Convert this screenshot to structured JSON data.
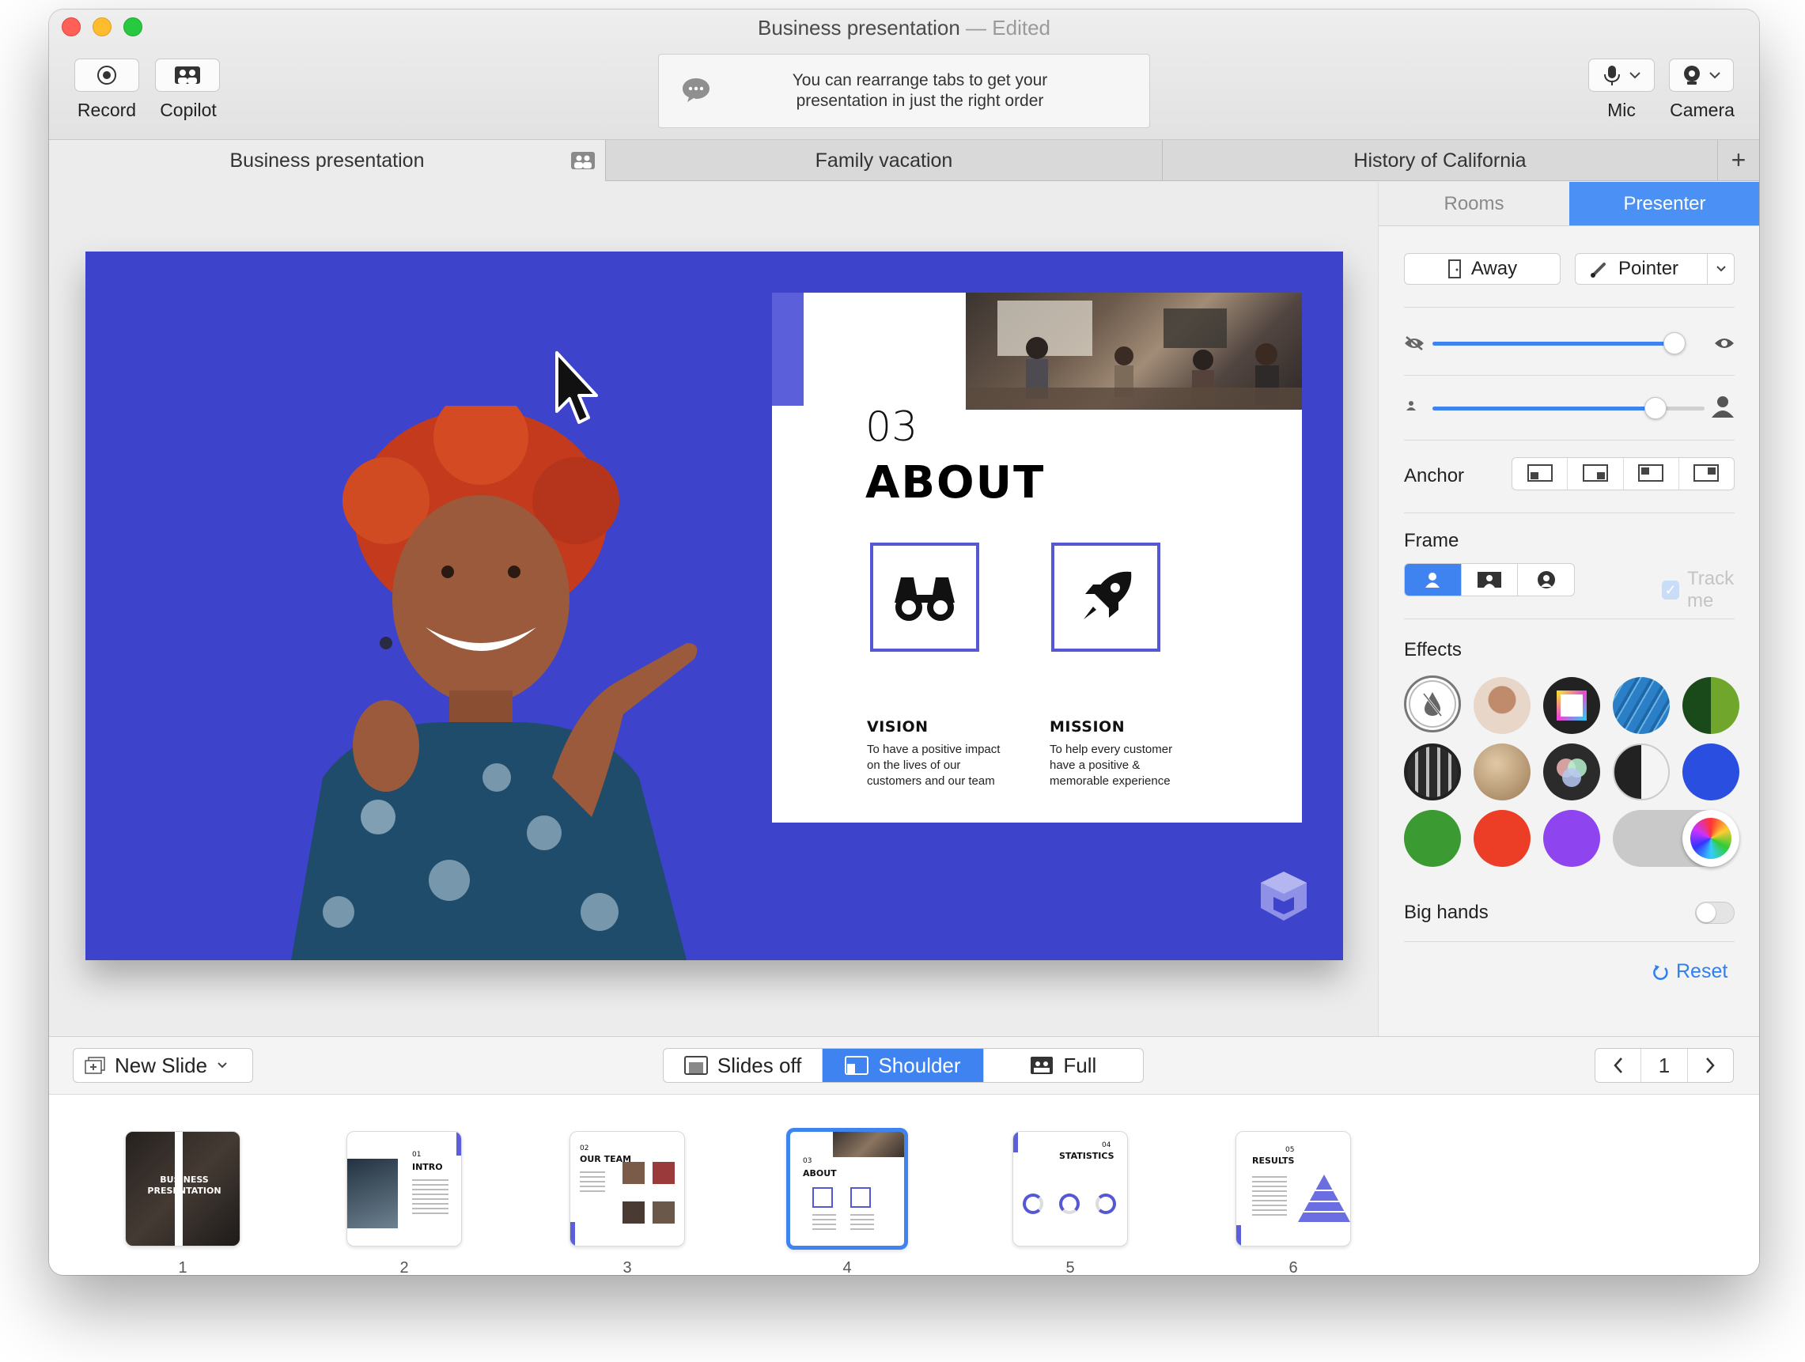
{
  "window": {
    "title": "Business presentation",
    "title_suffix": " — Edited"
  },
  "toolbar": {
    "record_label": "Record",
    "copilot_label": "Copilot",
    "notice": "You can rearrange tabs to get your presentation in just the right order",
    "mic_label": "Mic",
    "camera_label": "Camera"
  },
  "tabs": [
    {
      "label": "Business presentation",
      "active": true
    },
    {
      "label": "Family vacation",
      "active": false
    },
    {
      "label": "History of California",
      "active": false
    }
  ],
  "tab_add": "+",
  "slide": {
    "number": "03",
    "title": "ABOUT",
    "vision_heading": "VISION",
    "vision_text": "To have a positive impact on the lives of our customers and our team",
    "mission_heading": "MISSION",
    "mission_text": "To help every customer have a positive & memorable experience",
    "background_color": "#3d43cb"
  },
  "panel": {
    "tabs": [
      "Rooms",
      "Presenter"
    ],
    "active_tab": "Presenter",
    "away_label": "Away",
    "pointer_label": "Pointer",
    "visibility_slider": 0.98,
    "size_slider": 0.82,
    "anchor_label": "Anchor",
    "frame_label": "Frame",
    "track_me_label": "Track me",
    "effects_label": "Effects",
    "big_hands_label": "Big hands",
    "big_hands_on": false,
    "reset_label": "Reset",
    "accent_color": "#3f83f0"
  },
  "bottom": {
    "new_slide_label": "New Slide",
    "views": [
      "Slides off",
      "Shoulder",
      "Full"
    ],
    "active_view": "Shoulder",
    "page": "1",
    "prev": "‹",
    "next": "›"
  },
  "thumbnails": [
    {
      "num": "1",
      "title": "BUSINESS PRESENTATION"
    },
    {
      "num": "2",
      "title": "INTRO",
      "index": "01"
    },
    {
      "num": "3",
      "title": "OUR TEAM",
      "index": "02"
    },
    {
      "num": "4",
      "title": "ABOUT",
      "index": "03",
      "selected": true
    },
    {
      "num": "5",
      "title": "STATISTICS",
      "index": "04"
    },
    {
      "num": "6",
      "title": "RESULTS",
      "index": "05"
    }
  ]
}
